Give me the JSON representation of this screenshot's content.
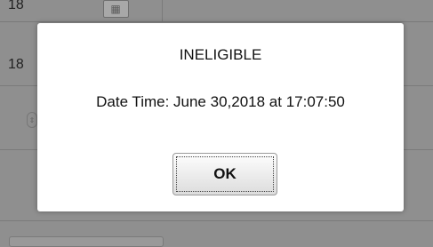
{
  "background": {
    "top_field_value": "18",
    "middle_field_value": "18"
  },
  "dialog": {
    "title": "INELIGIBLE",
    "message": "Date Time: June 30,2018 at 17:07:50",
    "ok_label": "OK"
  },
  "icons": {
    "calendar": "calendar-icon",
    "spinner": "spinner-icon"
  }
}
